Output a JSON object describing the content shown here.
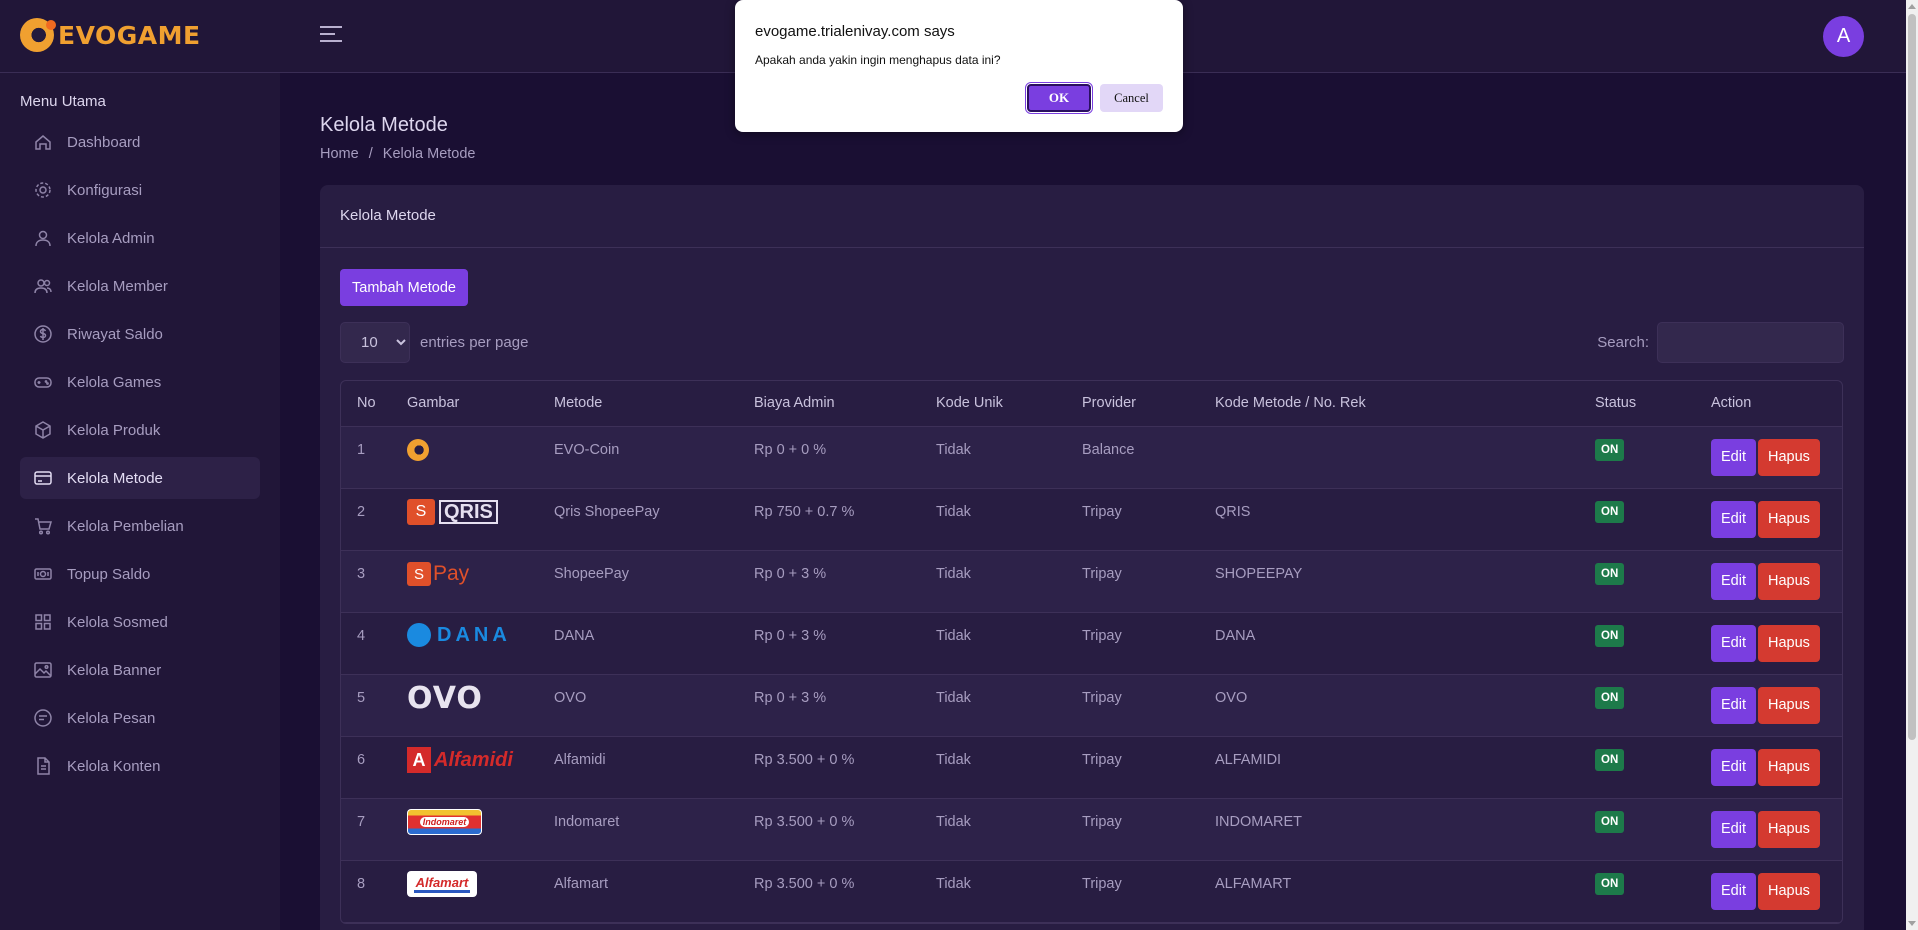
{
  "brand": {
    "name": "EVOGAME"
  },
  "header": {
    "avatar_letter": "A"
  },
  "sidebar": {
    "heading": "Menu Utama",
    "items": [
      {
        "label": "Dashboard",
        "icon": "home-icon"
      },
      {
        "label": "Konfigurasi",
        "icon": "gear-icon"
      },
      {
        "label": "Kelola Admin",
        "icon": "user-icon"
      },
      {
        "label": "Kelola Member",
        "icon": "users-icon"
      },
      {
        "label": "Riwayat Saldo",
        "icon": "dollar-circle-icon"
      },
      {
        "label": "Kelola Games",
        "icon": "gamepad-icon"
      },
      {
        "label": "Kelola Produk",
        "icon": "box-icon"
      },
      {
        "label": "Kelola Metode",
        "icon": "credit-card-icon",
        "active": true
      },
      {
        "label": "Kelola Pembelian",
        "icon": "cart-icon"
      },
      {
        "label": "Topup Saldo",
        "icon": "money-icon"
      },
      {
        "label": "Kelola Sosmed",
        "icon": "grid-icon"
      },
      {
        "label": "Kelola Banner",
        "icon": "image-icon"
      },
      {
        "label": "Kelola Pesan",
        "icon": "chat-icon"
      },
      {
        "label": "Kelola Konten",
        "icon": "document-icon"
      }
    ]
  },
  "page": {
    "title": "Kelola Metode",
    "breadcrumb": {
      "home": "Home",
      "sep": "/",
      "current": "Kelola Metode"
    }
  },
  "card": {
    "title": "Kelola Metode",
    "add_button": "Tambah Metode",
    "entries_value": "10",
    "entries_label": "entries per page",
    "search_label": "Search:"
  },
  "table": {
    "columns": [
      "No",
      "Gambar",
      "Metode",
      "Biaya Admin",
      "Kode Unik",
      "Provider",
      "Kode Metode / No. Rek",
      "Status",
      "Action"
    ],
    "edit_label": "Edit",
    "delete_label": "Hapus",
    "rows": [
      {
        "no": "1",
        "logo": "evo-coin",
        "metode": "EVO-Coin",
        "biaya": "Rp 0 + 0 %",
        "kode_unik": "Tidak",
        "provider": "Balance",
        "kode": "",
        "status": "ON"
      },
      {
        "no": "2",
        "logo": "qris-shopeepay",
        "metode": "Qris ShopeePay",
        "biaya": "Rp 750 + 0.7 %",
        "kode_unik": "Tidak",
        "provider": "Tripay",
        "kode": "QRIS",
        "status": "ON"
      },
      {
        "no": "3",
        "logo": "shopeepay",
        "metode": "ShopeePay",
        "biaya": "Rp 0 + 3 %",
        "kode_unik": "Tidak",
        "provider": "Tripay",
        "kode": "SHOPEEPAY",
        "status": "ON"
      },
      {
        "no": "4",
        "logo": "dana",
        "metode": "DANA",
        "biaya": "Rp 0 + 3 %",
        "kode_unik": "Tidak",
        "provider": "Tripay",
        "kode": "DANA",
        "status": "ON"
      },
      {
        "no": "5",
        "logo": "ovo",
        "metode": "OVO",
        "biaya": "Rp 0 + 3 %",
        "kode_unik": "Tidak",
        "provider": "Tripay",
        "kode": "OVO",
        "status": "ON"
      },
      {
        "no": "6",
        "logo": "alfamidi",
        "metode": "Alfamidi",
        "biaya": "Rp 3.500 + 0 %",
        "kode_unik": "Tidak",
        "provider": "Tripay",
        "kode": "ALFAMIDI",
        "status": "ON"
      },
      {
        "no": "7",
        "logo": "indomaret",
        "metode": "Indomaret",
        "biaya": "Rp 3.500 + 0 %",
        "kode_unik": "Tidak",
        "provider": "Tripay",
        "kode": "INDOMARET",
        "status": "ON"
      },
      {
        "no": "8",
        "logo": "alfamart",
        "metode": "Alfamart",
        "biaya": "Rp 3.500 + 0 %",
        "kode_unik": "Tidak",
        "provider": "Tripay",
        "kode": "ALFAMART",
        "status": "ON"
      }
    ]
  },
  "logo_text": {
    "qris": "QRIS",
    "shopee": "S",
    "pay": "Pay",
    "dana": "DANA",
    "ovo": "OVO",
    "alfamidi_a": "A",
    "alfamidi": "Alfamidi",
    "indomaret": "Indomaret",
    "alfamart": "Alfamart"
  },
  "dialog": {
    "title": "evogame.trialenivay.com says",
    "message": "Apakah anda yakin ingin menghapus data ini?",
    "ok": "OK",
    "cancel": "Cancel"
  },
  "colors": {
    "accent": "#7a3ee0",
    "danger": "#d43a30",
    "success": "#1d7a4a",
    "brand": "#f0a030"
  }
}
